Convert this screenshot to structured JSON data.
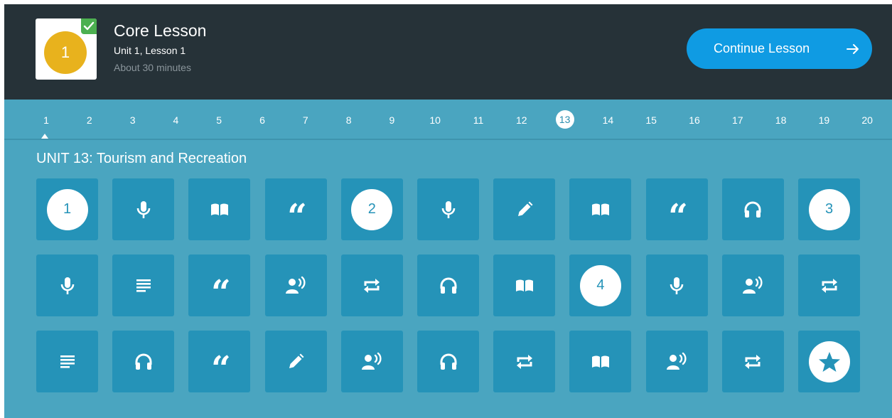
{
  "header": {
    "badge_number": "1",
    "title": "Core Lesson",
    "subtitle": "Unit 1, Lesson 1",
    "duration": "About 30 minutes",
    "continue_label": "Continue Lesson"
  },
  "units": {
    "numbers": [
      "1",
      "2",
      "3",
      "4",
      "5",
      "6",
      "7",
      "8",
      "9",
      "10",
      "11",
      "12",
      "13",
      "14",
      "15",
      "16",
      "17",
      "18",
      "19",
      "20"
    ],
    "active": "13",
    "current_title": "UNIT 13: Tourism and Recreation"
  },
  "tiles": [
    {
      "type": "lesson",
      "label": "1"
    },
    {
      "type": "microphone-icon"
    },
    {
      "type": "book-icon"
    },
    {
      "type": "quote-icon"
    },
    {
      "type": "lesson",
      "label": "2"
    },
    {
      "type": "microphone-icon"
    },
    {
      "type": "pencil-icon"
    },
    {
      "type": "book-icon"
    },
    {
      "type": "quote-icon"
    },
    {
      "type": "headphones-icon"
    },
    {
      "type": "lesson",
      "label": "3"
    },
    {
      "type": "microphone-icon"
    },
    {
      "type": "text-lines-icon"
    },
    {
      "type": "quote-icon"
    },
    {
      "type": "speaker-icon"
    },
    {
      "type": "repeat-icon"
    },
    {
      "type": "headphones-icon"
    },
    {
      "type": "book-icon"
    },
    {
      "type": "lesson",
      "label": "4"
    },
    {
      "type": "microphone-icon"
    },
    {
      "type": "speaker-icon"
    },
    {
      "type": "repeat-icon"
    },
    {
      "type": "text-lines-icon"
    },
    {
      "type": "headphones-icon"
    },
    {
      "type": "quote-icon"
    },
    {
      "type": "pencil-icon"
    },
    {
      "type": "speaker-icon"
    },
    {
      "type": "headphones-icon"
    },
    {
      "type": "repeat-icon"
    },
    {
      "type": "book-icon"
    },
    {
      "type": "speaker-icon"
    },
    {
      "type": "repeat-icon"
    },
    {
      "type": "star-icon"
    }
  ],
  "colors": {
    "header_bg": "#263238",
    "content_bg": "#4aa5c0",
    "tile_bg": "#2593b8",
    "accent_button": "#0f9be3",
    "badge_yellow": "#e8b21d",
    "check_green": "#4cb050"
  }
}
